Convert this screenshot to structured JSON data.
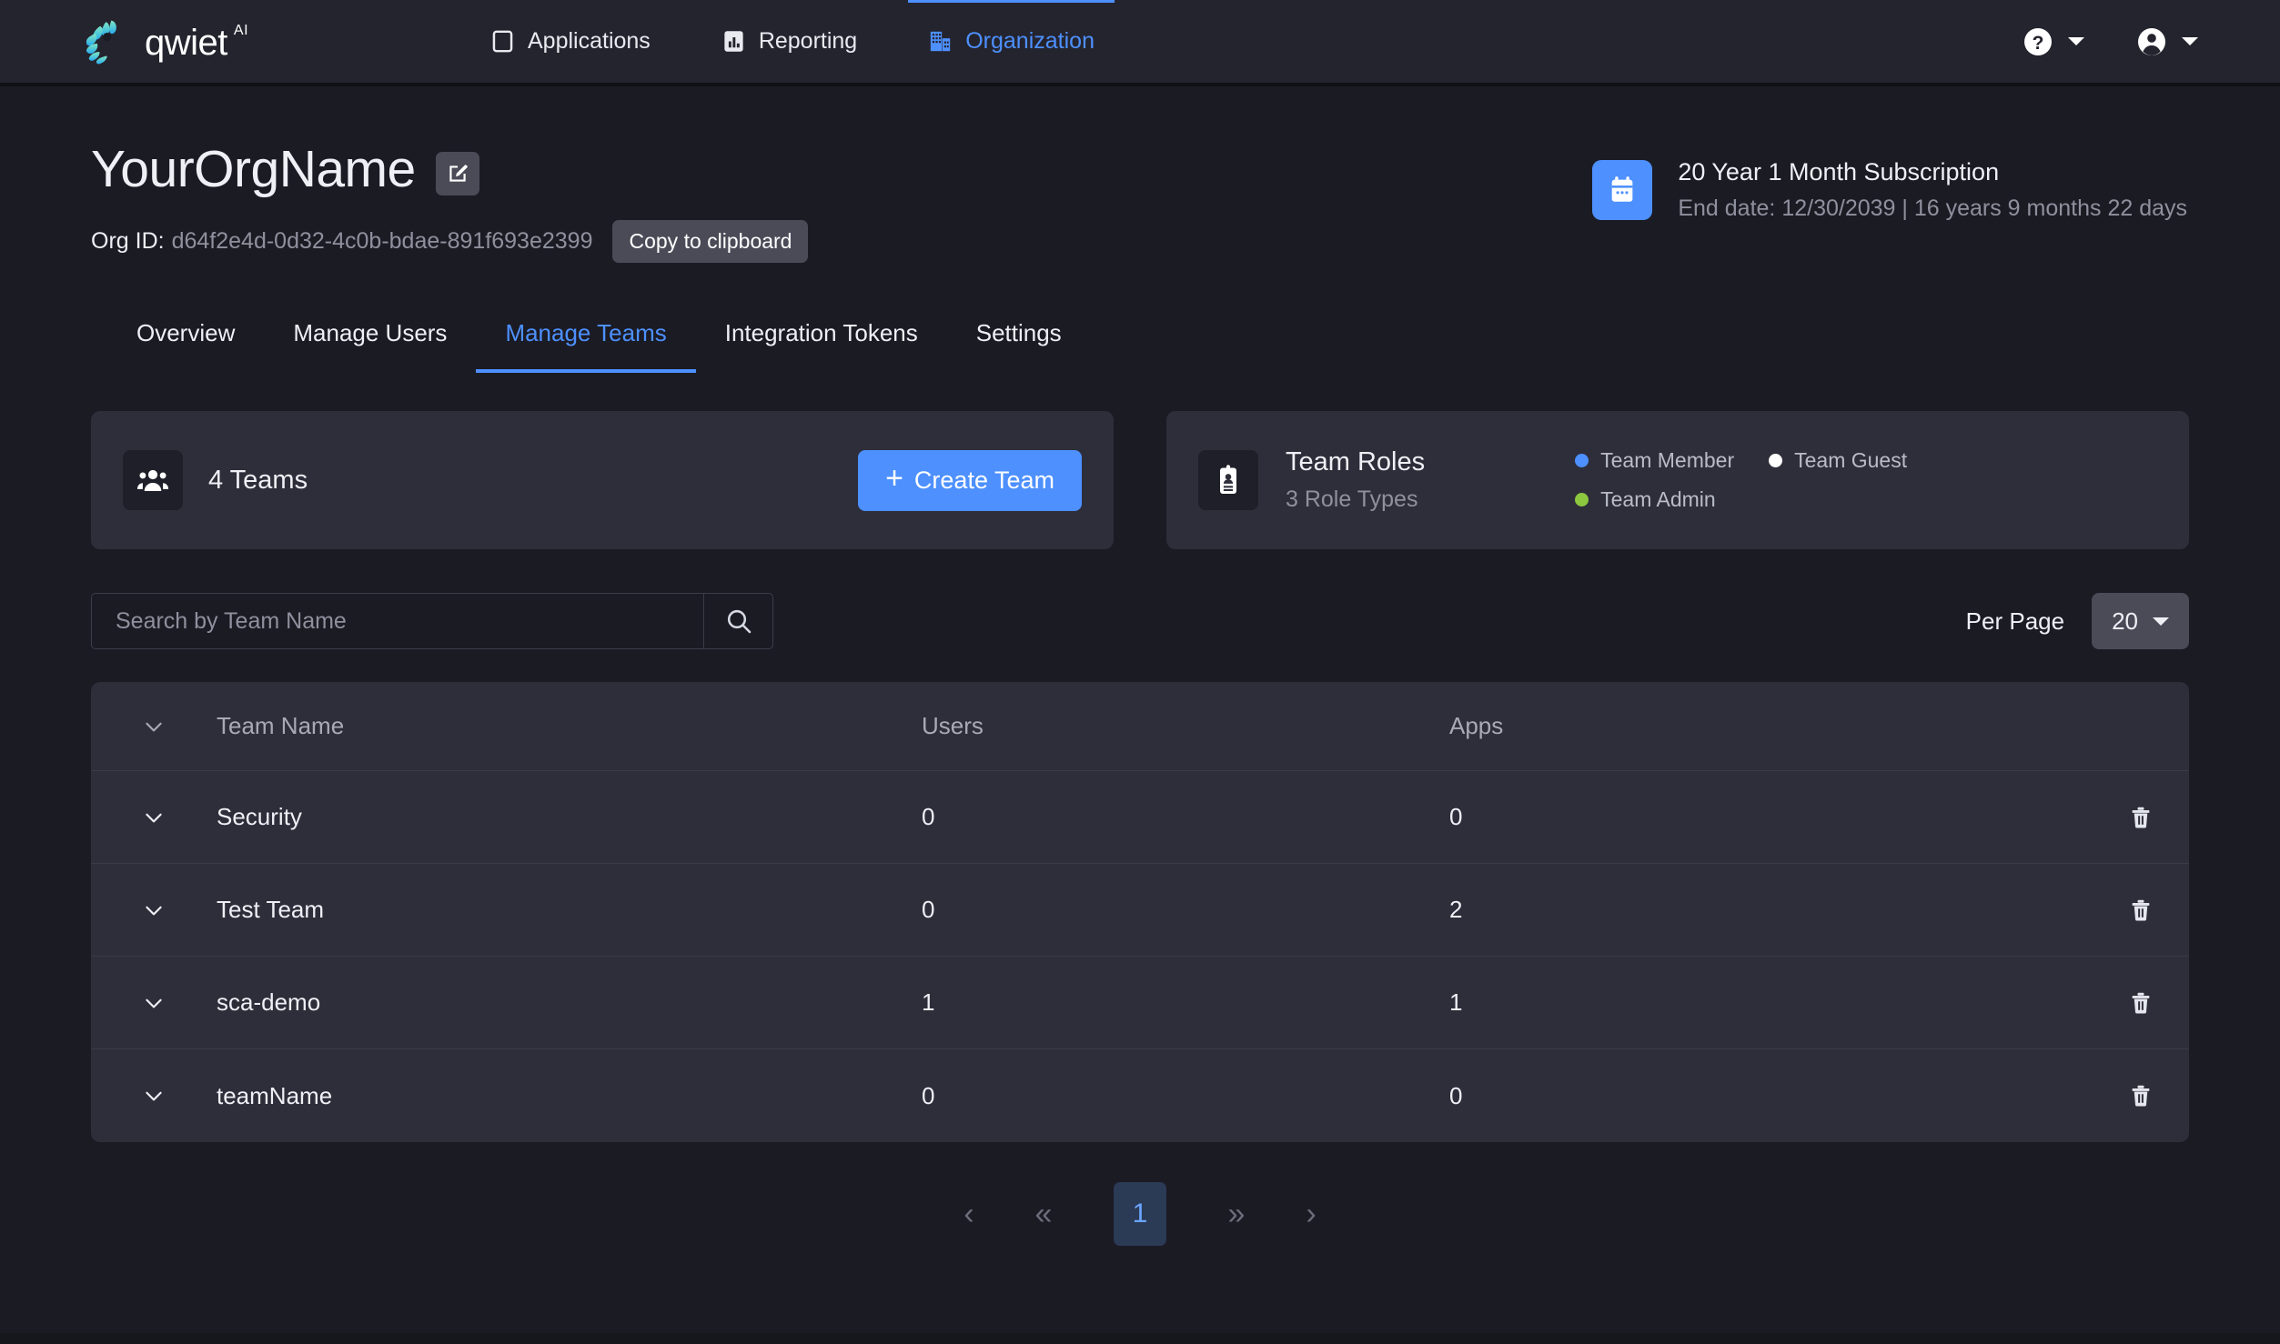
{
  "brand": {
    "name": "qwiet",
    "superscript": "AI",
    "logo_icon": "qwiet-spiral-logo"
  },
  "topnav": {
    "items": [
      {
        "label": "Applications",
        "icon": "window-icon",
        "active": false
      },
      {
        "label": "Reporting",
        "icon": "bar-chart-icon",
        "active": false
      },
      {
        "label": "Organization",
        "icon": "building-icon",
        "active": true
      }
    ],
    "help": {
      "icon": "help-circle-icon",
      "caret": "chevron-down-icon"
    },
    "account": {
      "icon": "account-circle-icon",
      "caret": "chevron-down-icon"
    }
  },
  "header": {
    "org_name": "YourOrgName",
    "edit_icon": "edit-square-icon",
    "org_id_label": "Org ID:",
    "org_id_value": "d64f2e4d-0d32-4c0b-bdae-891f693e2399",
    "copy_label": "Copy to clipboard"
  },
  "subscription": {
    "icon": "calendar-icon",
    "title": "20 Year 1 Month Subscription",
    "details": "End date: 12/30/2039 | 16 years 9 months 22 days"
  },
  "tabs": [
    {
      "label": "Overview",
      "active": false
    },
    {
      "label": "Manage Users",
      "active": false
    },
    {
      "label": "Manage Teams",
      "active": true
    },
    {
      "label": "Integration Tokens",
      "active": false
    },
    {
      "label": "Settings",
      "active": false
    }
  ],
  "teams_card": {
    "icon": "people-group-icon",
    "count_label": "4 Teams",
    "create_button": "Create Team",
    "create_plus": "+"
  },
  "roles_card": {
    "icon": "id-badge-icon",
    "title": "Team Roles",
    "subtitle": "3 Role Types",
    "legend": [
      {
        "label": "Team Member",
        "color": "#4d90fe"
      },
      {
        "label": "Team Guest",
        "color": "#ffffff"
      },
      {
        "label": "Team Admin",
        "color": "#8dc63f"
      }
    ]
  },
  "toolbar": {
    "search_placeholder": "Search by Team Name",
    "search_value": "",
    "search_icon": "search-icon",
    "per_page_label": "Per Page",
    "per_page_value": "20"
  },
  "table": {
    "columns": [
      "Team Name",
      "Users",
      "Apps"
    ],
    "rows": [
      {
        "name": "Security",
        "users": "0",
        "apps": "0"
      },
      {
        "name": "Test Team",
        "users": "0",
        "apps": "2"
      },
      {
        "name": "sca-demo",
        "users": "1",
        "apps": "1"
      },
      {
        "name": "teamName",
        "users": "0",
        "apps": "0"
      }
    ],
    "expand_icon": "chevron-down-icon",
    "delete_icon": "trash-icon"
  },
  "pagination": {
    "prev": "‹",
    "first": "«",
    "current_page": "1",
    "last": "»",
    "next": "›"
  },
  "colors": {
    "accent": "#4d90fe",
    "page_bg": "#1b1b24",
    "topbar_bg": "#24242e",
    "card_bg": "#2e2e3a",
    "muted_text": "#8e919d"
  }
}
